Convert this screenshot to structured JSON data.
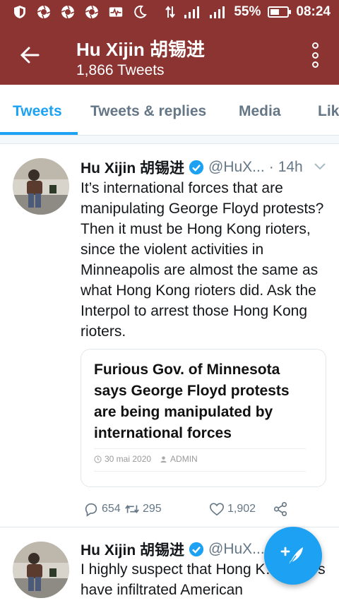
{
  "status_bar": {
    "battery_percent": "55%",
    "battery_level": 0.55,
    "time": "08:24",
    "icons": [
      "shield-icon",
      "aperture-icon",
      "aperture-icon",
      "aperture-icon",
      "activity-icon",
      "moon-icon",
      "data-arrows-icon",
      "signal-icon",
      "signal-icon"
    ]
  },
  "app_bar": {
    "title": "Hu Xijin 胡锡进",
    "subtitle": "1,866 Tweets",
    "background": "#8b3432"
  },
  "tabs": [
    {
      "label": "Tweets",
      "active": true
    },
    {
      "label": "Tweets & replies",
      "active": false
    },
    {
      "label": "Media",
      "active": false
    },
    {
      "label": "Lik",
      "active": false
    }
  ],
  "accent_color": "#1da1f2",
  "tweets": [
    {
      "name": "Hu Xijin 胡锡进",
      "handle": "@HuX...",
      "separator": "·",
      "time": "14h",
      "text": "It’s international forces that are manipulating George Floyd protests? Then it must be Hong Kong rioters, since the violent activities in Minneapolis are almost the same as what Hong Kong rioters did. Ask the Interpol to arrest those Hong Kong rioters.",
      "card": {
        "title": "Furious Gov. of Minnesota says George Floyd protests are being manipulated by international forces",
        "date": "30 mai 2020",
        "author": "ADMIN"
      },
      "replies": "654",
      "retweets": "295",
      "likes": "1,902"
    },
    {
      "name": "Hu Xijin 胡锡进",
      "handle": "@HuX...",
      "text": "I highly suspect that Hong K… rioters have infiltrated American"
    }
  ]
}
